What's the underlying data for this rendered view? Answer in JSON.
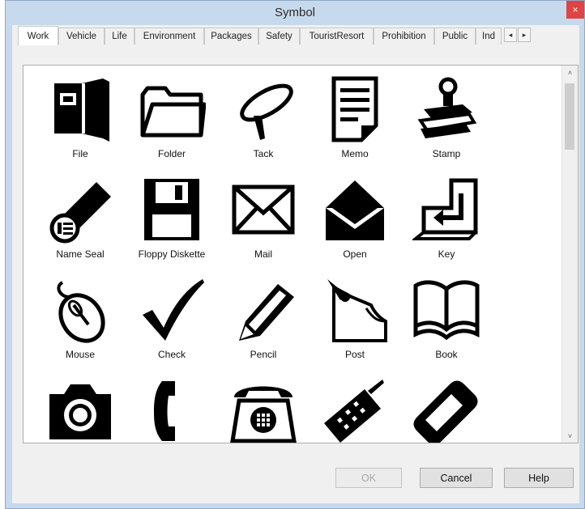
{
  "window": {
    "title": "Symbol",
    "close_glyph": "×"
  },
  "tabs": [
    {
      "label": "Work",
      "active": true
    },
    {
      "label": "Vehicle",
      "active": false
    },
    {
      "label": "Life",
      "active": false
    },
    {
      "label": "Environment",
      "active": false
    },
    {
      "label": "Packages",
      "active": false
    },
    {
      "label": "Safety",
      "active": false
    },
    {
      "label": "TouristResort",
      "active": false
    },
    {
      "label": "Prohibition",
      "active": false
    },
    {
      "label": "Public",
      "active": false
    },
    {
      "label": "Ind",
      "active": false
    }
  ],
  "tab_scroll": {
    "left_glyph": "◂",
    "right_glyph": "▸"
  },
  "symbols": [
    {
      "label": "File",
      "icon": "file-icon"
    },
    {
      "label": "Folder",
      "icon": "folder-icon"
    },
    {
      "label": "Tack",
      "icon": "tack-icon"
    },
    {
      "label": "Memo",
      "icon": "memo-icon"
    },
    {
      "label": "Stamp",
      "icon": "stamp-icon"
    },
    {
      "label": "Name Seal",
      "icon": "name-seal-icon"
    },
    {
      "label": "Floppy Diskette",
      "icon": "floppy-icon"
    },
    {
      "label": "Mail",
      "icon": "mail-icon"
    },
    {
      "label": "Open",
      "icon": "open-mail-icon"
    },
    {
      "label": "Key",
      "icon": "enter-key-icon"
    },
    {
      "label": "Mouse",
      "icon": "mouse-icon"
    },
    {
      "label": "Check",
      "icon": "check-icon"
    },
    {
      "label": "Pencil",
      "icon": "pencil-icon"
    },
    {
      "label": "Post",
      "icon": "post-icon"
    },
    {
      "label": "Book",
      "icon": "book-icon"
    },
    {
      "label": "",
      "icon": "camera-icon"
    },
    {
      "label": "",
      "icon": "telephone-receiver-icon"
    },
    {
      "label": "",
      "icon": "desk-phone-icon"
    },
    {
      "label": "",
      "icon": "cell-phone-icon"
    },
    {
      "label": "",
      "icon": "pager-icon"
    }
  ],
  "scrollbar": {
    "up_glyph": "˄",
    "down_glyph": "˅"
  },
  "buttons": {
    "ok": "OK",
    "cancel": "Cancel",
    "help": "Help"
  }
}
